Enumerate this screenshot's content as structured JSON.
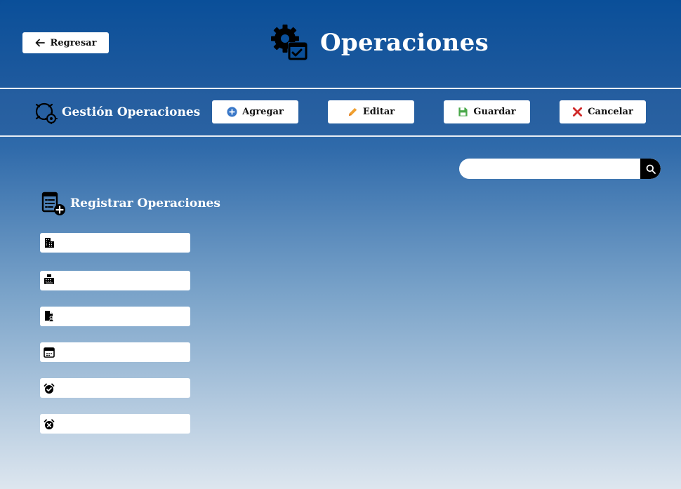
{
  "header": {
    "back_label": "Regresar",
    "title": "Operaciones"
  },
  "toolbar": {
    "section_title": "Gestión Operaciones",
    "add_label": "Agregar",
    "edit_label": "Editar",
    "save_label": "Guardar",
    "cancel_label": "Cancelar"
  },
  "search": {
    "value": "",
    "placeholder": ""
  },
  "form": {
    "title": "Registrar Operaciones",
    "fields": [
      {
        "icon": "building-icon",
        "value": ""
      },
      {
        "icon": "cash-register-icon",
        "value": ""
      },
      {
        "icon": "user-document-icon",
        "value": ""
      },
      {
        "icon": "calendar-icon",
        "value": ""
      },
      {
        "icon": "alarm-check-icon",
        "value": ""
      },
      {
        "icon": "alarm-off-icon",
        "value": ""
      }
    ]
  },
  "colors": {
    "header": "#0a4f99",
    "toolbar": "#2a62a2",
    "add_icon": "#3a78c8",
    "edit_icon": "#f0a030",
    "save_icon": "#4aa84a",
    "cancel_icon": "#d02a2a"
  }
}
